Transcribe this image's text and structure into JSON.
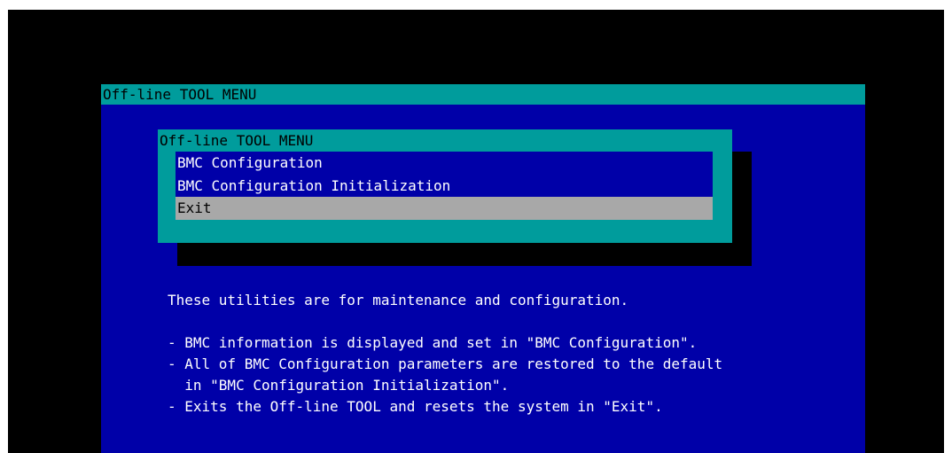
{
  "window": {
    "title": "Off-line TOOL MENU"
  },
  "menu": {
    "title": "Off-line TOOL MENU",
    "items": [
      {
        "label": "BMC Configuration"
      },
      {
        "label": "BMC Configuration Initialization"
      },
      {
        "label": "Exit"
      }
    ],
    "selected_index": 2
  },
  "description": {
    "intro": "These utilities are for maintenance and configuration.",
    "lines": [
      "- BMC information is displayed and set in \"BMC Configuration\".",
      "- All of BMC Configuration parameters are restored to the default",
      "  in \"BMC Configuration Initialization\".",
      "- Exits the Off-line TOOL and resets the system in \"Exit\"."
    ]
  },
  "colors": {
    "background": "#000000",
    "panel_blue": "#0000a8",
    "title_cyan": "#009c9c",
    "selection_gray": "#a8a8a8",
    "text_white": "#ffffff",
    "text_black": "#000000"
  }
}
